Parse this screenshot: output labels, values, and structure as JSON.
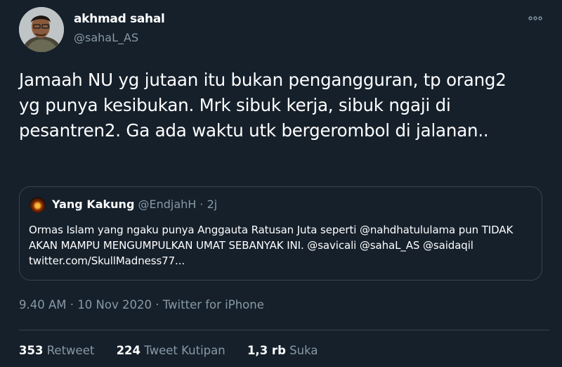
{
  "author": {
    "display_name": "akhmad sahal",
    "handle": "@sahaL_AS",
    "avatar_icon": "profile-photo"
  },
  "tweet": {
    "text": "Jamaah NU yg jutaan itu bukan pengangguran, tp orang2 yg punya kesibukan. Mrk sibuk kerja, sibuk ngaji di pesantren2. Ga ada waktu utk bergerombol di jalanan.."
  },
  "quoted_tweet": {
    "display_name": "Yang Kakung",
    "handle": "@EndjahH",
    "separator": "·",
    "age": "2j",
    "text": "Ormas Islam yang ngaku punya Anggauta Ratusan Juta seperti @nahdhatulula​ma pun TIDAK AKAN MAMPU MENGUMPULKAN UMAT SEBANYAK INI. @savicali @sahaL_AS  @saidaqil twitter.com/SkullMadness77..."
  },
  "meta": {
    "time": "9.40 AM",
    "separator": "·",
    "date": "10 Nov 2020",
    "source": "Twitter for iPhone"
  },
  "stats": {
    "retweets": "353",
    "retweets_label": "Retweet",
    "quotes": "224",
    "quotes_label": "Tweet Kutipan",
    "likes": "1,3 rb",
    "likes_label": "Suka"
  },
  "colors": {
    "background": "#15202b",
    "secondary_text": "#8899a6",
    "border": "#38444d"
  },
  "icons": {
    "more": "more-options-icon"
  }
}
